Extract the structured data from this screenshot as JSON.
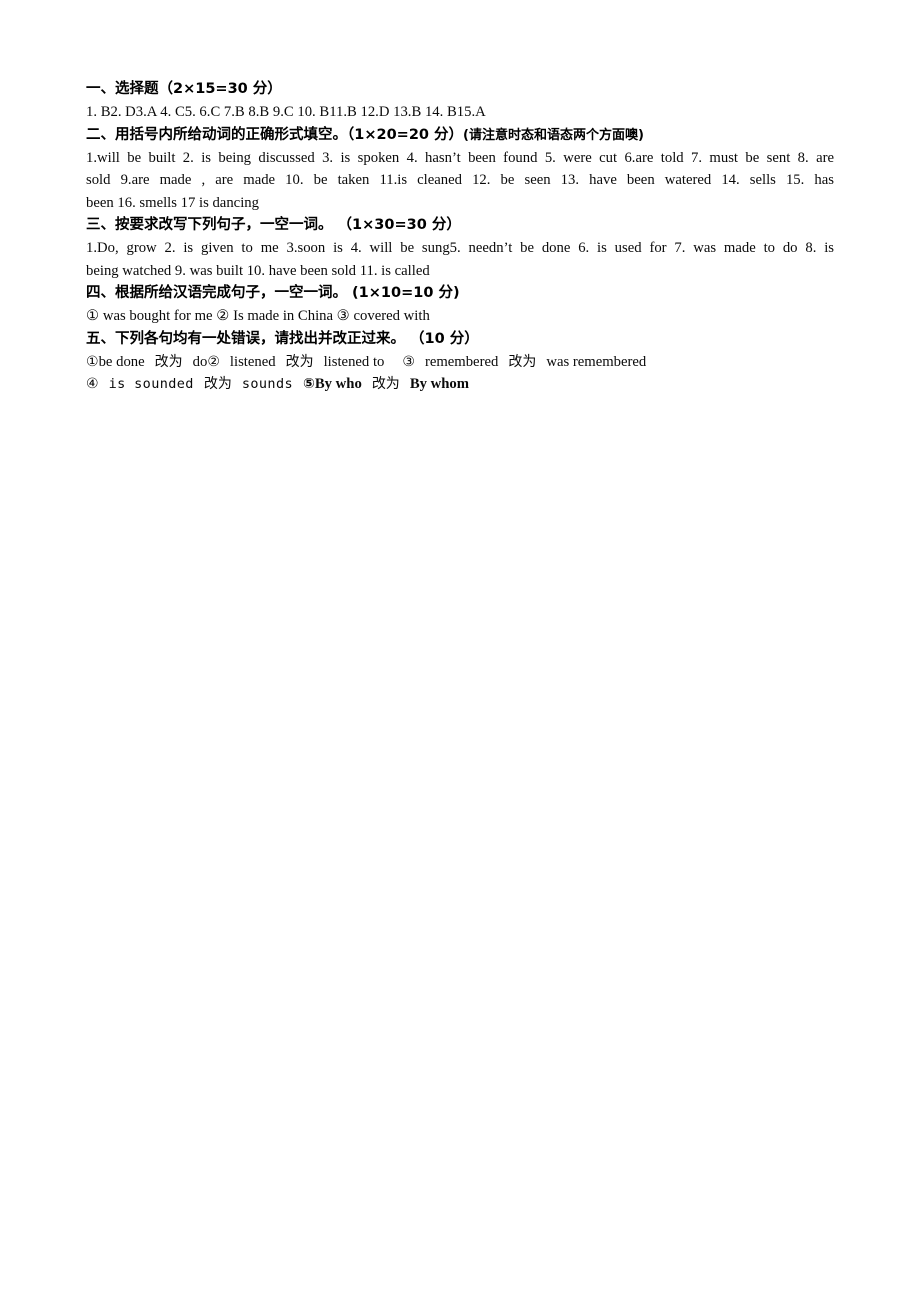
{
  "document": {
    "type": "answer-key",
    "language": "zh-CN",
    "sections": [
      {
        "id": "section-1",
        "heading": "一、选择题（2×15=30 分）",
        "lines": [
          "1. B2. D3.A 4. C5. 6.C 7.B 8.B 9.C 10. B11.B 12.D 13.B 14. B15.A"
        ]
      },
      {
        "id": "section-2",
        "heading": "二、用括号内所给动词的正确形式填空。（1×20=20 分）",
        "heading_note": "(请注意时态和语态两个方面噢)",
        "lines": [
          "1.will be built    2. is being discussed 3. is spoken 4. hasn’t been found 5. were cut 6.are told 7. must be sent 8. are",
          "sold    9.are made , are made 10. be taken    11.is cleaned 12. be seen    13. have been watered 14. sells 15. has",
          "been 16. smells 17 is dancing"
        ]
      },
      {
        "id": "section-3",
        "heading": "三、按要求改写下列句子，一空一词。 （1×30=30 分）",
        "lines": [
          "1.Do, grow 2. is given to me 3.soon is 4. will be sung5. needn’t be done 6. is used for 7. was made to do 8. is",
          "being watched 9. was built 10. have been sold 11. is called"
        ]
      },
      {
        "id": "section-4",
        "heading": "四、根据所给汉语完成句子，一空一词。 (1×10=10 分)",
        "lines": [
          "① was bought for me  ②  Is made in China  ③  covered with"
        ]
      },
      {
        "id": "section-5",
        "heading": "五、下列各句均有一处错误，请找出并改正过来。 （10 分）",
        "items_line_1": [
          {
            "mark": "①",
            "wrong": "be done",
            "label": "改为",
            "right": "do"
          },
          {
            "mark": "②",
            "wrong": "listened",
            "label": "改为",
            "right": "listened to"
          },
          {
            "mark": "③",
            "wrong": "remembered",
            "label": "改为",
            "right": "was remembered"
          }
        ],
        "items_line_2": [
          {
            "mark": "④",
            "wrong": "is sounded",
            "label": "改为",
            "right": "sounds"
          },
          {
            "mark": "⑤",
            "wrong": "By who",
            "label": "改为",
            "right": "By whom"
          }
        ],
        "line_1_text": "①be done 改为  do②  listened 改为  listened to  ③  remembered  改为  was remembered",
        "line_2_parts": {
          "mark4": "④",
          "wrong4": "is sounded",
          "label4": "改为",
          "right4": "sounds",
          "mark5": "⑤",
          "wrong5": "By who",
          "label5": "改为",
          "right5": "By whom"
        }
      }
    ]
  }
}
